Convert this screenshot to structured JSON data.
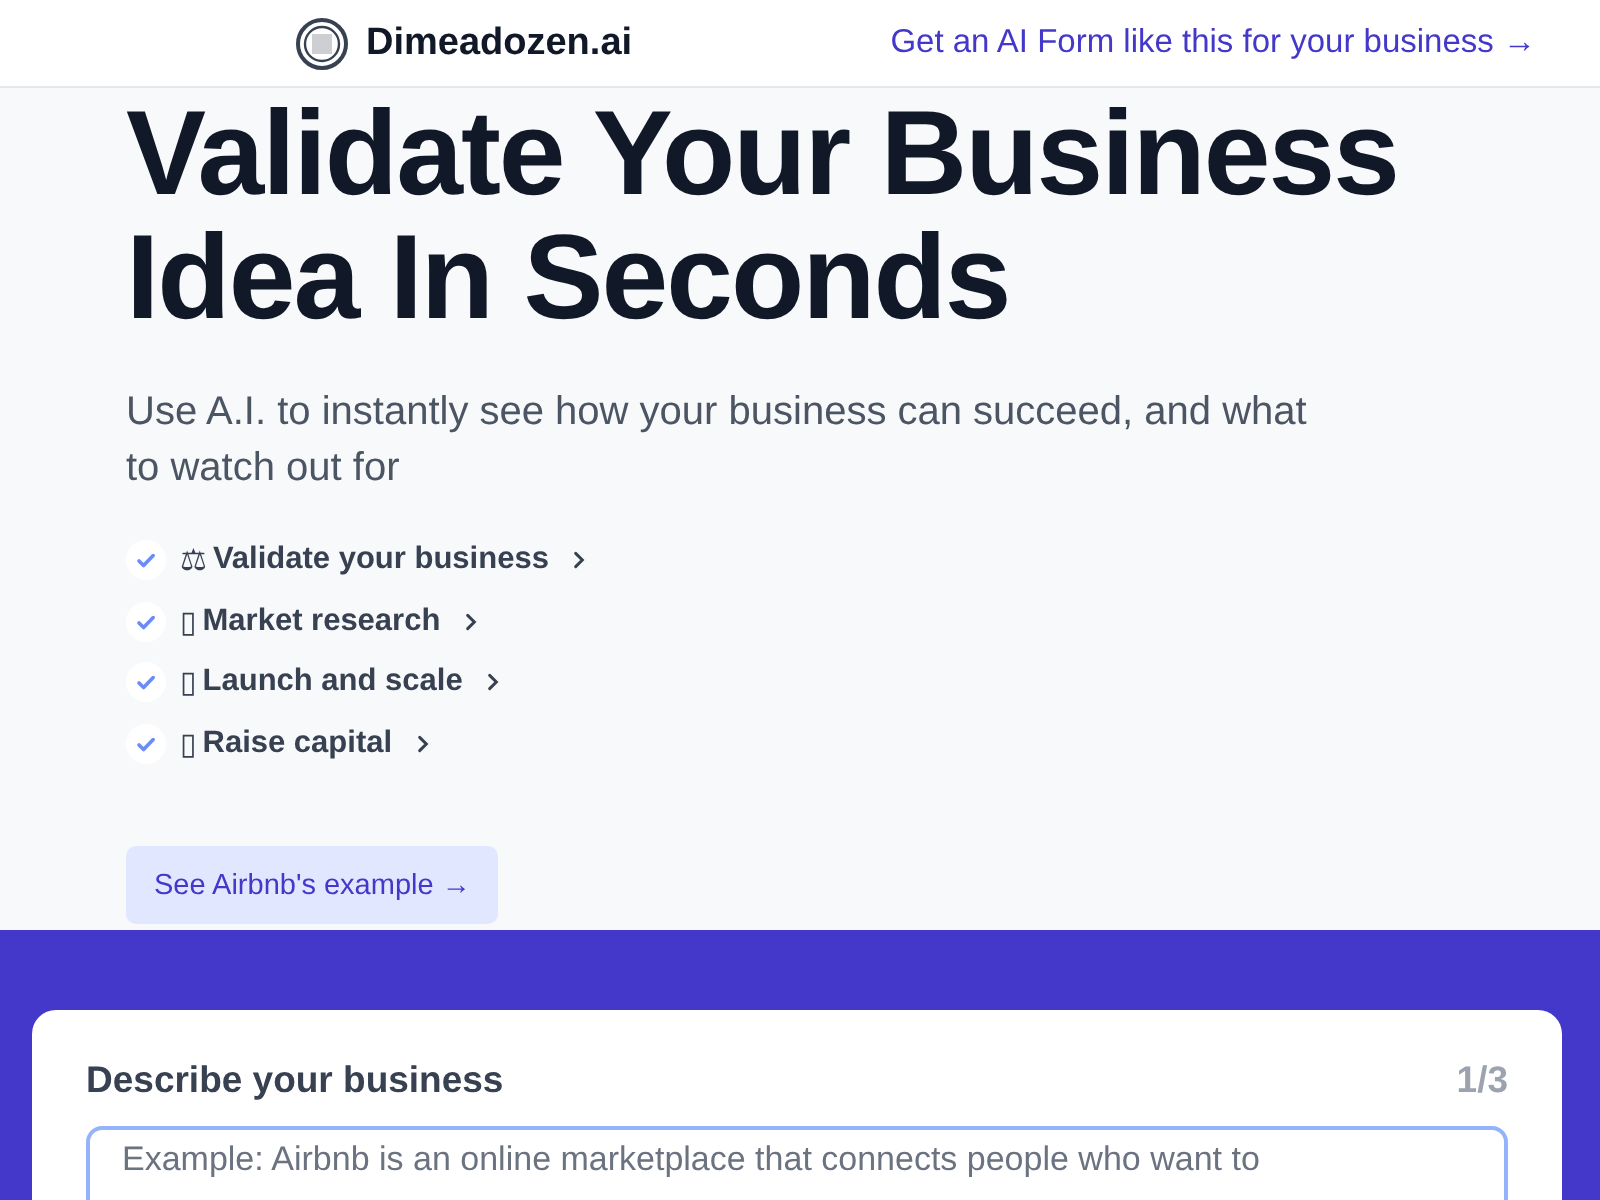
{
  "header": {
    "brand": "Dimeadozen.ai",
    "cta_link": "Get an AI Form like this for your business →"
  },
  "hero": {
    "title": "Validate Your Business Idea In Seconds",
    "subtitle": "Use A.I. to instantly see how your business can succeed, and what to watch out for",
    "features": [
      {
        "glyph": "⚖",
        "label": "Validate your business",
        "checked": true
      },
      {
        "glyph": "▯",
        "label": "Market research",
        "checked": true
      },
      {
        "glyph": "▯",
        "label": "Launch and scale",
        "checked": true
      },
      {
        "glyph": "▯",
        "label": "Raise capital",
        "checked": true
      }
    ],
    "example_button": "See Airbnb's example →"
  },
  "form": {
    "question": "Describe your business",
    "step": "1/3",
    "placeholder": "Example: Airbnb is an online marketplace that connects people who want to"
  }
}
